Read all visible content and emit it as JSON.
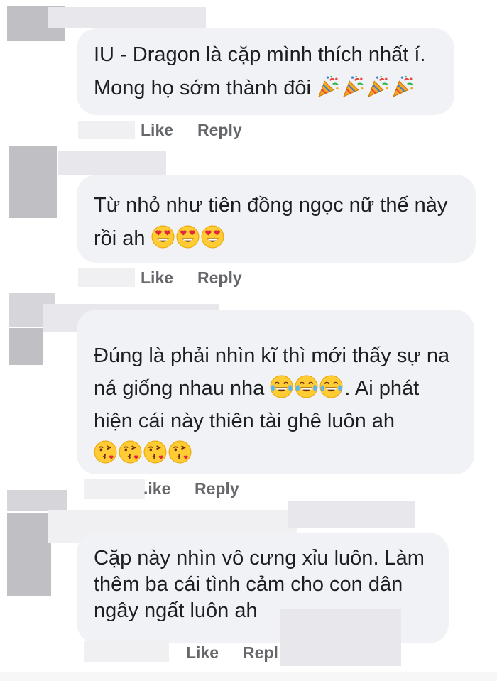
{
  "comments": [
    {
      "lines": [
        "IU - Dragon là cặp mình thích nhất í.",
        "Mong họ sớm thành đôi"
      ],
      "emoji_line": 1,
      "emoji": "party-popper",
      "emoji_count": 4
    },
    {
      "lines": [
        "Từ nhỏ như tiên đồng ngọc nữ thế này",
        "rồi ah"
      ],
      "emoji_line": 1,
      "emoji": "heart-eyes",
      "emoji_count": 3
    },
    {
      "lines": [
        "Đúng là phải nhìn kĩ thì mới thấy sự na",
        "ná giống nhau nha",
        "hiện cái này thiên tài ghê luôn ah"
      ],
      "line2_suffix": ". Ai phát",
      "emoji_line": 1,
      "emoji": "joy",
      "emoji_count": 3,
      "extra_emoji": "kissing-heart",
      "extra_emoji_count": 4
    },
    {
      "lines": [
        "Cặp này nhìn vô cưng xỉu luôn. Làm",
        "thêm ba cái tình cảm cho con dân",
        "ngây ngất luôn ah"
      ]
    }
  ],
  "actions": [
    {
      "like": "Like",
      "reply": "Reply"
    },
    {
      "like": "Like",
      "reply": "Reply"
    },
    {
      "like": ".ike",
      "reply": "Reply"
    },
    {
      "like": "Like",
      "reply": "Repl"
    }
  ],
  "colors": {
    "bubble": "#f0f2f5",
    "text": "#1c1e21",
    "action": "#65676b"
  }
}
